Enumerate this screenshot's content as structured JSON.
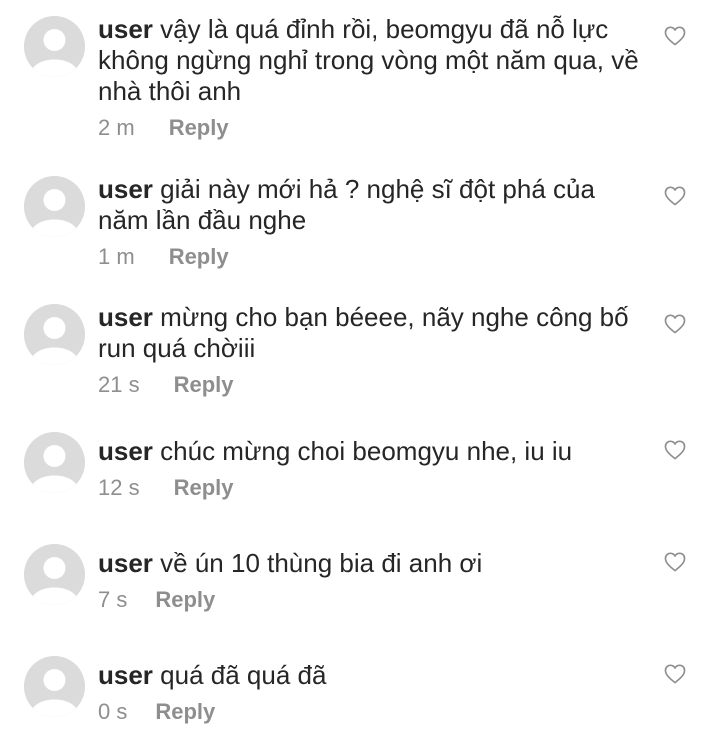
{
  "comments": [
    {
      "username": "user",
      "text": "vậy là quá đỉnh rồi, beomgyu đã nỗ lực không ngừng nghỉ trong vòng một năm qua, về nhà thôi anh",
      "time": "2 m",
      "reply_label": "Reply",
      "icon": "heart-outline-icon"
    },
    {
      "username": "user",
      "text": "giải này mới hả ? nghệ sĩ đột phá của năm lần đầu nghe",
      "time": "1 m",
      "reply_label": "Reply",
      "icon": "heart-outline-icon"
    },
    {
      "username": "user",
      "text": "mừng cho bạn béeee, nãy nghe công bố run quá chờiii",
      "time": "21 s",
      "reply_label": "Reply",
      "icon": "heart-outline-icon"
    },
    {
      "username": "user",
      "text": "chúc mừng choi beomgyu nhe, iu iu",
      "time": "12 s",
      "reply_label": "Reply",
      "icon": "heart-outline-icon"
    },
    {
      "username": "user",
      "text": "về ún 10 thùng bia đi anh ơi",
      "time": "7 s",
      "reply_label": "Reply",
      "icon": "heart-outline-icon"
    },
    {
      "username": "user",
      "text": "quá đã quá đã",
      "time": "0 s",
      "reply_label": "Reply",
      "icon": "heart-outline-icon"
    }
  ],
  "colors": {
    "text": "#262626",
    "secondary": "#8e8e8e",
    "avatar_bg": "#dbdbdb",
    "avatar_fg": "#ffffff"
  }
}
